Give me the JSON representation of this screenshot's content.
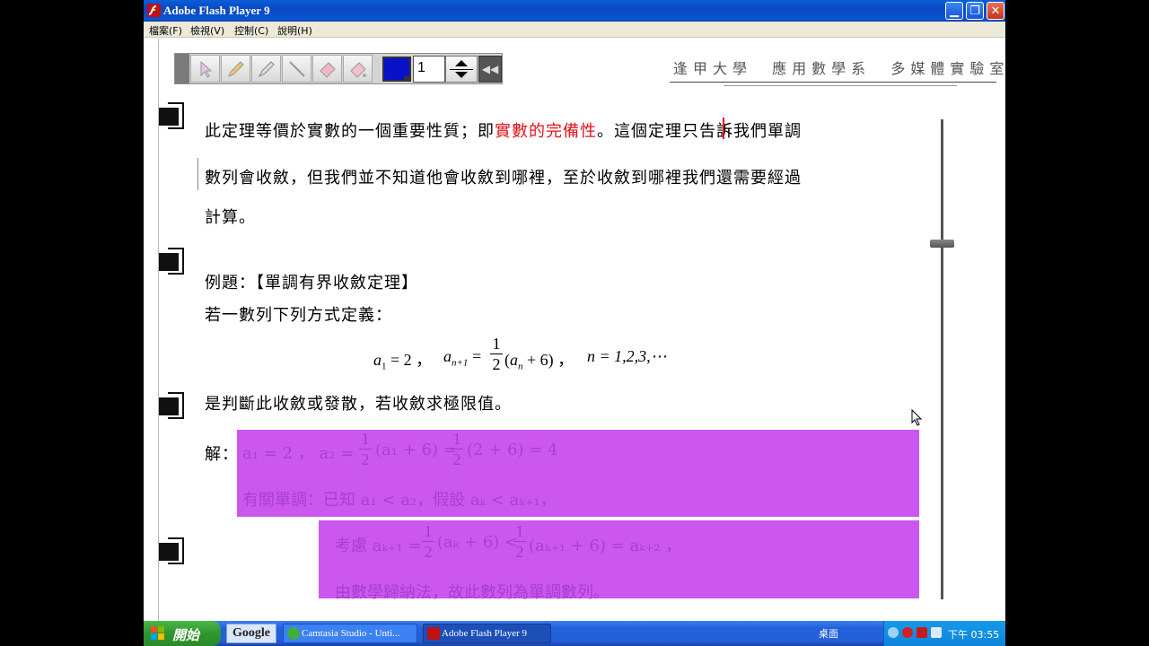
{
  "window": {
    "title": "Adobe Flash Player 9"
  },
  "menu": [
    "檔案(F)",
    "檢視(V)",
    "控制(C)",
    "說明(H)"
  ],
  "toolbar": {
    "tools": [
      "pointer-tool",
      "pencil-tool",
      "marker-tool",
      "line-tool",
      "eraser-tool",
      "clear-eraser-tool"
    ],
    "color": "#0a12c8",
    "page_value": "1"
  },
  "header": {
    "title": "逢甲大學  應用數學系  多媒體實驗室"
  },
  "content": {
    "p1_a": "此定理等價於實數的一個重要性質；即",
    "p1_red": "實數的完備性",
    "p1_b": "。這個定理只告訴我們單調",
    "p2": "數列會收斂，但我們並不知道他會收斂到哪裡，至於收斂到哪裡我們還需要經過",
    "p3": "計算。",
    "example_title": "例題：【單調有界收斂定理】",
    "example_def": "若一數列下列方式定義：",
    "formula": {
      "a1": "a",
      "a1_sub": "1",
      "eq1": " = 2 ，",
      "an1": "a",
      "an1_sub": "n+1",
      "eq2": " =",
      "frac_num": "1",
      "frac_den": "2",
      "paren": "(a",
      "paren_sub": "n",
      "paren_end": " + 6) ，",
      "n_part": "n = 1,2,3,⋯"
    },
    "question": "是判斷此收斂或發散，若收斂求極限值。",
    "solution_label": "解：",
    "sol1_a": "a₁ = 2 ，   a₂ =",
    "sol1_frac_num": "1",
    "sol1_frac_den": "2",
    "sol1_b": "(a₁ + 6) =",
    "sol1_frac2_num": "1",
    "sol1_frac2_den": "2",
    "sol1_c": "(2 + 6) = 4",
    "sol2": "有關單調：已知 a₁ < a₂，假設 aₖ < aₖ₊₁，",
    "sol3_a": "考慮 aₖ₊₁ =",
    "sol3_frac_num": "1",
    "sol3_frac_den": "2",
    "sol3_b": "(aₖ + 6) <",
    "sol3_frac2_num": "1",
    "sol3_frac2_den": "2",
    "sol3_c": "(aₖ₊₁ + 6) = aₖ₊₂ ，",
    "sol4": "由數學歸納法，故此數列為單調數列。"
  },
  "colors": {
    "highlight": "#cc57f0",
    "accent_red": "#e0131b",
    "titlebar": "#0849c2"
  },
  "taskbar": {
    "start_label": "開始",
    "google_label": "Google",
    "tasks": [
      "Camtasia Studio - Unti...",
      "Adobe Flash Player 9"
    ],
    "desktop_label": "桌面",
    "clock": "下午 03:55"
  }
}
